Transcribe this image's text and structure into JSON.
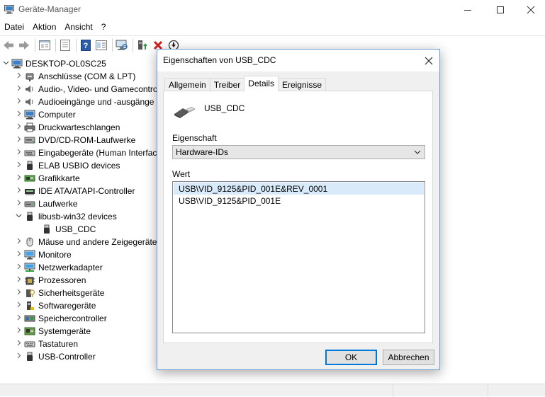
{
  "window": {
    "title": "Geräte-Manager"
  },
  "menu": [
    "Datei",
    "Aktion",
    "Ansicht",
    "?"
  ],
  "tree": {
    "root": "DESKTOP-OL0SC25",
    "items": [
      {
        "label": "Anschlüsse (COM & LPT)",
        "icon": "port-icon"
      },
      {
        "label": "Audio-, Video- und Gamecontroller",
        "icon": "speaker-icon"
      },
      {
        "label": "Audioeingänge und -ausgänge",
        "icon": "speaker-icon"
      },
      {
        "label": "Computer",
        "icon": "computer-icon"
      },
      {
        "label": "Druckwarteschlangen",
        "icon": "printer-icon"
      },
      {
        "label": "DVD/CD-ROM-Laufwerke",
        "icon": "dvd-icon"
      },
      {
        "label": "Eingabegeräte (Human Interface Devices)",
        "icon": "hid-icon"
      },
      {
        "label": "ELAB USBIO devices",
        "icon": "usb-plug-icon"
      },
      {
        "label": "Grafikkarte",
        "icon": "display-adapter-icon"
      },
      {
        "label": "IDE ATA/ATAPI-Controller",
        "icon": "ide-icon"
      },
      {
        "label": "Laufwerke",
        "icon": "drive-icon"
      },
      {
        "label": "libusb-win32 devices",
        "icon": "usb-plug-icon",
        "expanded": true
      },
      {
        "label": "USB_CDC",
        "icon": "usb-plug-icon",
        "child": true
      },
      {
        "label": "Mäuse und andere Zeigegeräte",
        "icon": "mouse-icon"
      },
      {
        "label": "Monitore",
        "icon": "monitor-icon"
      },
      {
        "label": "Netzwerkadapter",
        "icon": "network-icon"
      },
      {
        "label": "Prozessoren",
        "icon": "cpu-icon"
      },
      {
        "label": "Sicherheitsgeräte",
        "icon": "security-icon"
      },
      {
        "label": "Softwaregeräte",
        "icon": "software-device-icon"
      },
      {
        "label": "Speichercontroller",
        "icon": "storage-controller-icon"
      },
      {
        "label": "Systemgeräte",
        "icon": "system-device-icon"
      },
      {
        "label": "Tastaturen",
        "icon": "keyboard-icon"
      },
      {
        "label": "USB-Controller",
        "icon": "usb-plug-icon"
      }
    ]
  },
  "dialog": {
    "title": "Eigenschaften von USB_CDC",
    "tabs": [
      "Allgemein",
      "Treiber",
      "Details",
      "Ereignisse"
    ],
    "active_tab": "Details",
    "device_name": "USB_CDC",
    "property_label": "Eigenschaft",
    "property_value": "Hardware-IDs",
    "value_label": "Wert",
    "values": [
      "USB\\VID_9125&PID_001E&REV_0001",
      "USB\\VID_9125&PID_001E"
    ],
    "ok_label": "OK",
    "cancel_label": "Abbrechen"
  },
  "colors": {
    "accent": "#0078d7",
    "selection": "#d9ebfa"
  }
}
